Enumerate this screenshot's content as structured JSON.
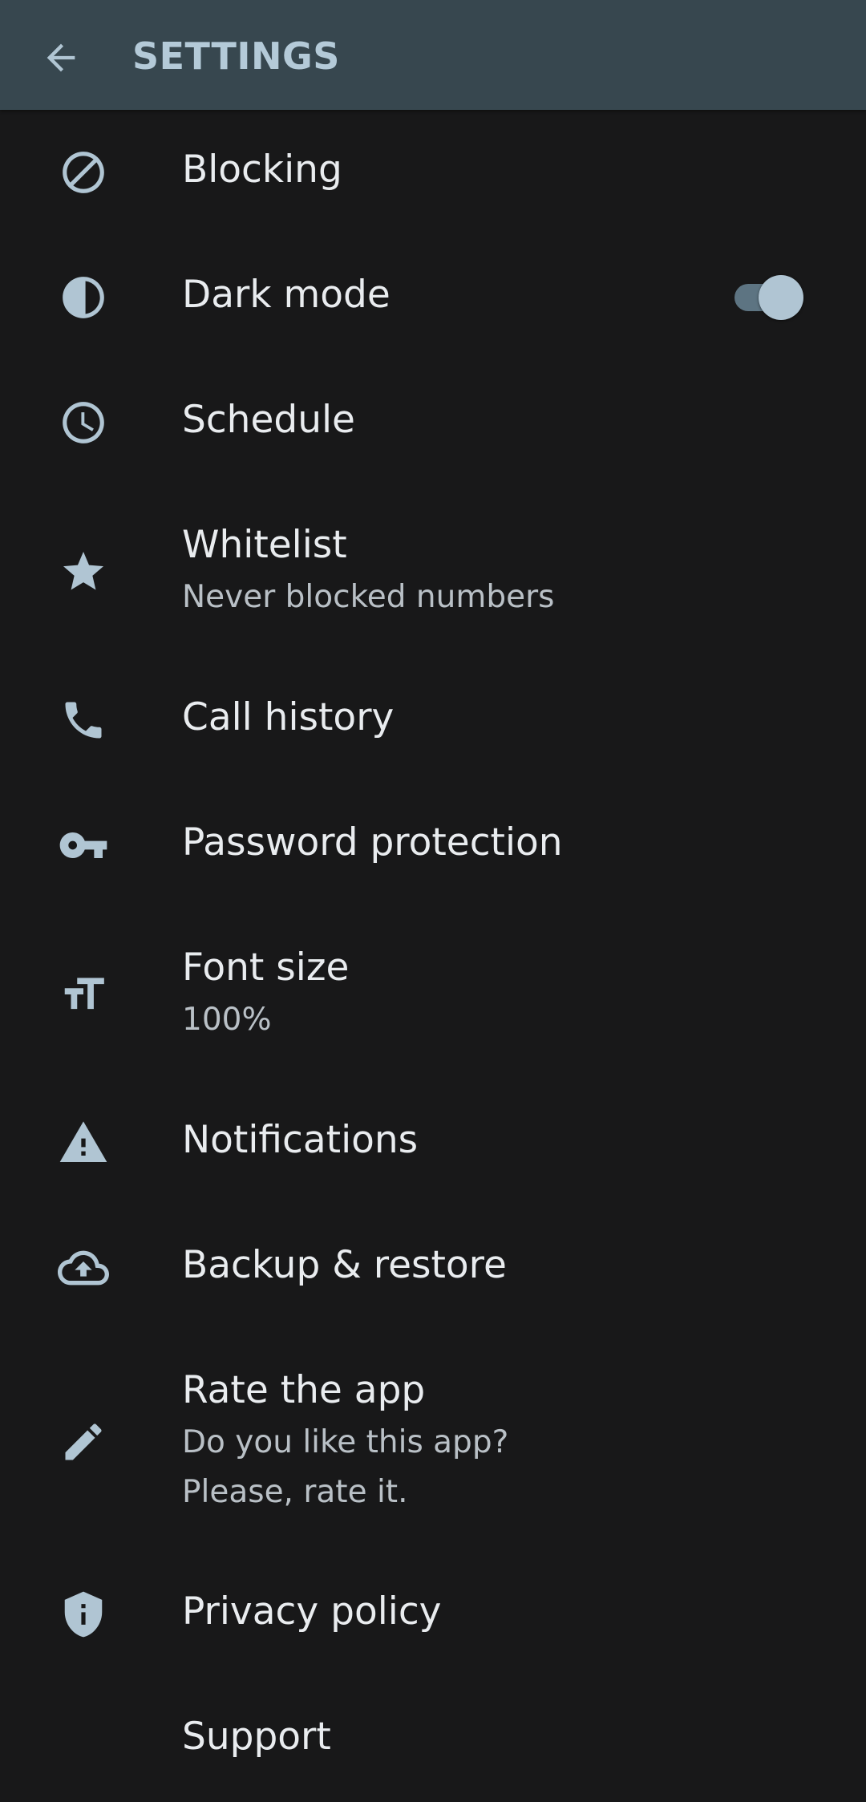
{
  "appbar": {
    "title": "SETTINGS",
    "back_icon": "arrow-back-icon"
  },
  "colors": {
    "appbar_background": "#37474f",
    "accent": "#b0c5d3",
    "background": "#181819",
    "icon": "#b0c5d3"
  },
  "settings": {
    "items": [
      {
        "title": "Blocking",
        "icon": "block-icon"
      },
      {
        "title": "Dark mode",
        "icon": "contrast-icon",
        "toggle_on": true
      },
      {
        "title": "Schedule",
        "icon": "clock-icon"
      },
      {
        "title": "Whitelist",
        "summary": "Never blocked numbers",
        "icon": "star-icon"
      },
      {
        "title": "Call history",
        "icon": "phone-icon"
      },
      {
        "title": "Password protection",
        "icon": "key-icon"
      },
      {
        "title": "Font size",
        "summary": "100%",
        "icon": "text-size-icon"
      },
      {
        "title": "Notifications",
        "icon": "warning-icon"
      },
      {
        "title": "Backup & restore",
        "icon": "cloud-upload-icon"
      },
      {
        "title": "Rate the app",
        "summary": "Do you like this app?",
        "summary2": "Please, rate it.",
        "icon": "pencil-icon"
      },
      {
        "title": "Privacy policy",
        "icon": "shield-icon"
      },
      {
        "title": "Support",
        "icon": "support-icon"
      }
    ]
  }
}
